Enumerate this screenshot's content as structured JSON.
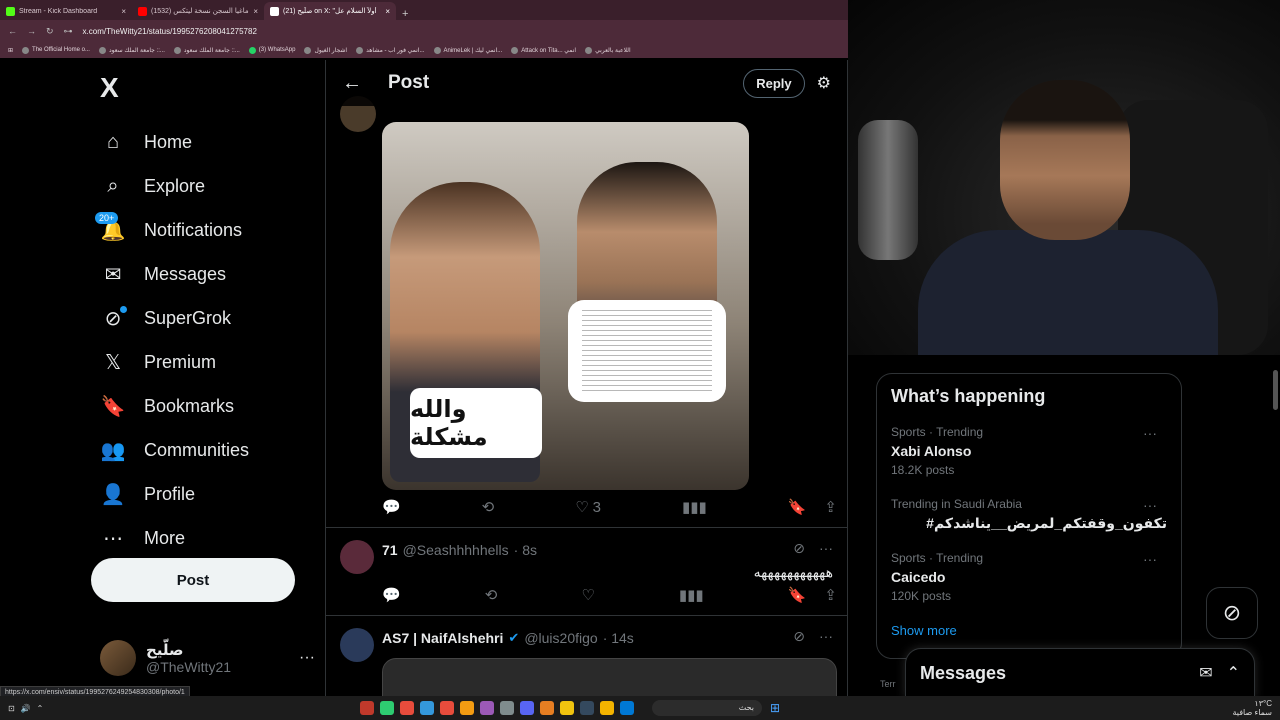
{
  "browser": {
    "tabs": [
      {
        "label": "Stream - Kick Dashboard",
        "color": "#53fc18"
      },
      {
        "label": "ماغيا السجن نسخة ليتكس (1532)",
        "color": "#ff0000"
      },
      {
        "label": "(21) صلّيح on X: \"أولاً السلام عل",
        "color": "#ffffff"
      }
    ],
    "url": "x.com/TheWitty21/status/1995276208041275782",
    "bookmarks": [
      "The Official Home o...",
      "جامعة الملك سعود ::...",
      "جامعة الملك سعود ::...",
      "(3) WhatsApp",
      "اشجار الغيول",
      "انمي فور اب - مشاهد...",
      "AnimeLek | انمي ليك...",
      "Attack on Tita... انمي",
      "اللاعبة بالعربي"
    ]
  },
  "sidebar": {
    "logo": "X",
    "items": [
      {
        "label": "Home",
        "icon": "⌂"
      },
      {
        "label": "Explore",
        "icon": "⌕"
      },
      {
        "label": "Notifications",
        "icon": "🔔",
        "badge": "20+"
      },
      {
        "label": "Messages",
        "icon": "✉"
      },
      {
        "label": "SuperGrok",
        "icon": "⊘"
      },
      {
        "label": "Premium",
        "icon": "𝕏"
      },
      {
        "label": "Bookmarks",
        "icon": "🔖"
      },
      {
        "label": "Communities",
        "icon": "👥"
      },
      {
        "label": "Profile",
        "icon": "👤"
      },
      {
        "label": "More",
        "icon": "⋯"
      }
    ],
    "post_button": "Post",
    "account": {
      "name": "صلّيح",
      "handle": "@TheWitty21"
    }
  },
  "main": {
    "title": "Post",
    "reply_button": "Reply",
    "photo_caption_left": "والله مشكلة",
    "post1_likes": "3",
    "replies": [
      {
        "name": "71",
        "handle": "@Seashhhhhells",
        "time": "· 8s",
        "text": "هههههههههههه"
      },
      {
        "name": "AS7 | NaifAlshehri",
        "handle": "@luis20figo",
        "time": "· 14s",
        "verified": true
      }
    ]
  },
  "right": {
    "happening_title": "What’s happening",
    "trends": [
      {
        "meta": "Sports · Trending",
        "name": "Xabi Alonso",
        "count": "18.2K posts"
      },
      {
        "meta": "Trending in Saudi Arabia",
        "name": "#تكفون_وقفتكم_لمريض__يناشدكم",
        "count": ""
      },
      {
        "meta": "Sports · Trending",
        "name": "Caicedo",
        "count": "120K posts"
      }
    ],
    "show_more": "Show more",
    "messages_title": "Messages",
    "terms_snippet": "Terr"
  },
  "status_url": "https://x.com/ensiv/status/1995276249254830308/photo/1",
  "taskbar": {
    "search_placeholder": "بحث",
    "temperature": "١٣°C",
    "weather": "سماء صافية"
  }
}
